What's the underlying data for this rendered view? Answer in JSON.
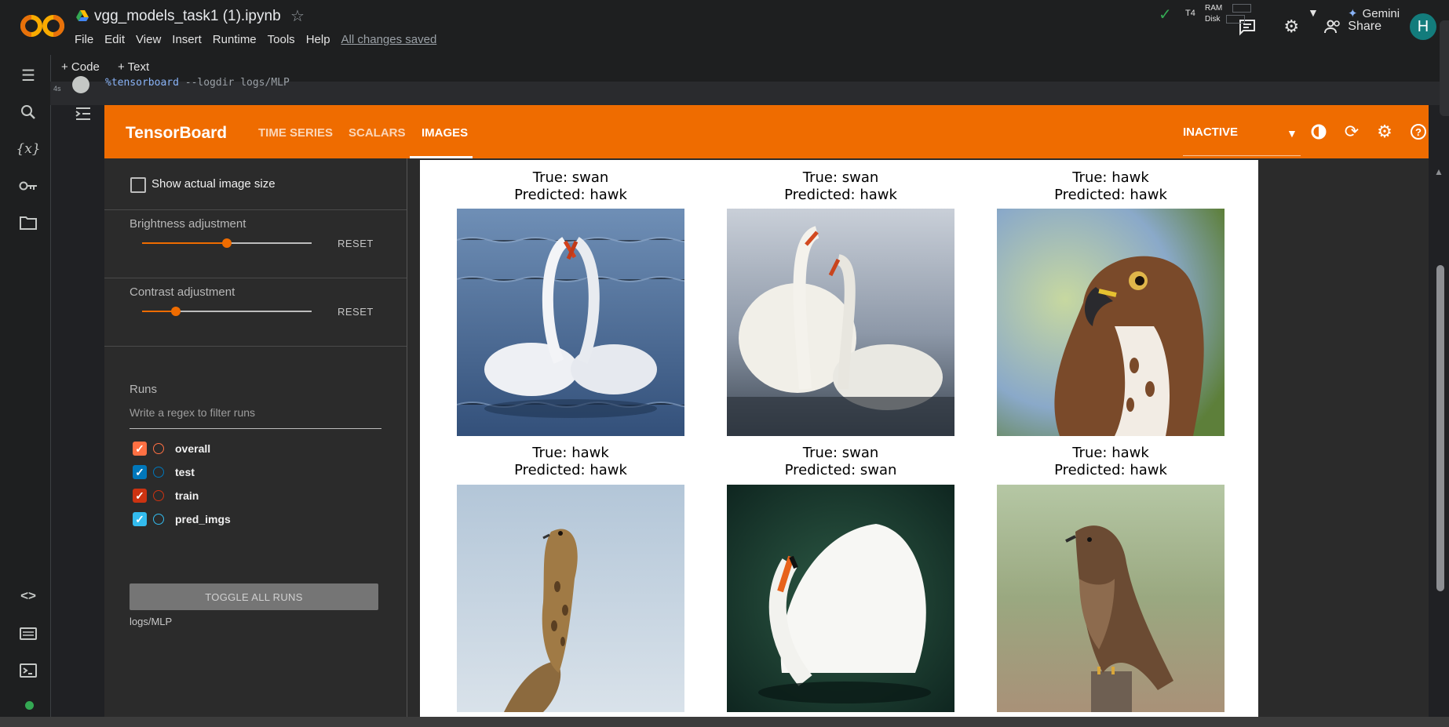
{
  "colab": {
    "notebook_title": "vgg_models_task1 (1).ipynb",
    "menu": [
      "File",
      "Edit",
      "View",
      "Insert",
      "Runtime",
      "Tools",
      "Help"
    ],
    "save_status": "All changes saved",
    "share_label": "Share",
    "avatar_initial": "H",
    "toolbar": {
      "code_label": "+ Code",
      "text_label": "+ Text"
    },
    "runtime": {
      "gpu": "T4",
      "ram_label": "RAM",
      "disk_label": "Disk"
    },
    "gemini_label": "Gemini",
    "cell": {
      "exec_time": "4s",
      "magic": "%tensorboard",
      "args": " --logdir logs/MLP"
    }
  },
  "tensorboard": {
    "brand": "TensorBoard",
    "tabs": [
      "TIME SERIES",
      "SCALARS",
      "IMAGES"
    ],
    "active_tab": "IMAGES",
    "status": "INACTIVE",
    "sidebar": {
      "show_actual_size_label": "Show actual image size",
      "brightness": {
        "label": "Brightness adjustment",
        "value": 0.5,
        "reset": "RESET"
      },
      "contrast": {
        "label": "Contrast adjustment",
        "value": 0.2,
        "reset": "RESET"
      },
      "runs_title": "Runs",
      "filter_placeholder": "Write a regex to filter runs",
      "runs": [
        {
          "name": "overall",
          "checked": true,
          "color": "#ff7043"
        },
        {
          "name": "test",
          "checked": true,
          "color": "#0077bb"
        },
        {
          "name": "train",
          "checked": true,
          "color": "#cc3311"
        },
        {
          "name": "pred_imgs",
          "checked": true,
          "color": "#33bbee"
        }
      ],
      "toggle_all_label": "TOGGLE ALL RUNS",
      "logdir": "logs/MLP"
    },
    "predictions": [
      {
        "true_label": "True: swan",
        "pred_label": "Predicted: hawk",
        "subject": "two-swans-heart"
      },
      {
        "true_label": "True: swan",
        "pred_label": "Predicted: hawk",
        "subject": "two-swans-pond"
      },
      {
        "true_label": "True: hawk",
        "pred_label": "Predicted: hawk",
        "subject": "hawk-portrait"
      },
      {
        "true_label": "True: hawk",
        "pred_label": "Predicted: hawk",
        "subject": "hawk-on-branch"
      },
      {
        "true_label": "True: swan",
        "pred_label": "Predicted: swan",
        "subject": "swan-dark-water"
      },
      {
        "true_label": "True: hawk",
        "pred_label": "Predicted: hawk",
        "subject": "hawk-on-post"
      }
    ]
  },
  "colors": {
    "tb_orange": "#ef6c00",
    "colab_bg": "#1e1f20",
    "active_green": "#34a853"
  }
}
